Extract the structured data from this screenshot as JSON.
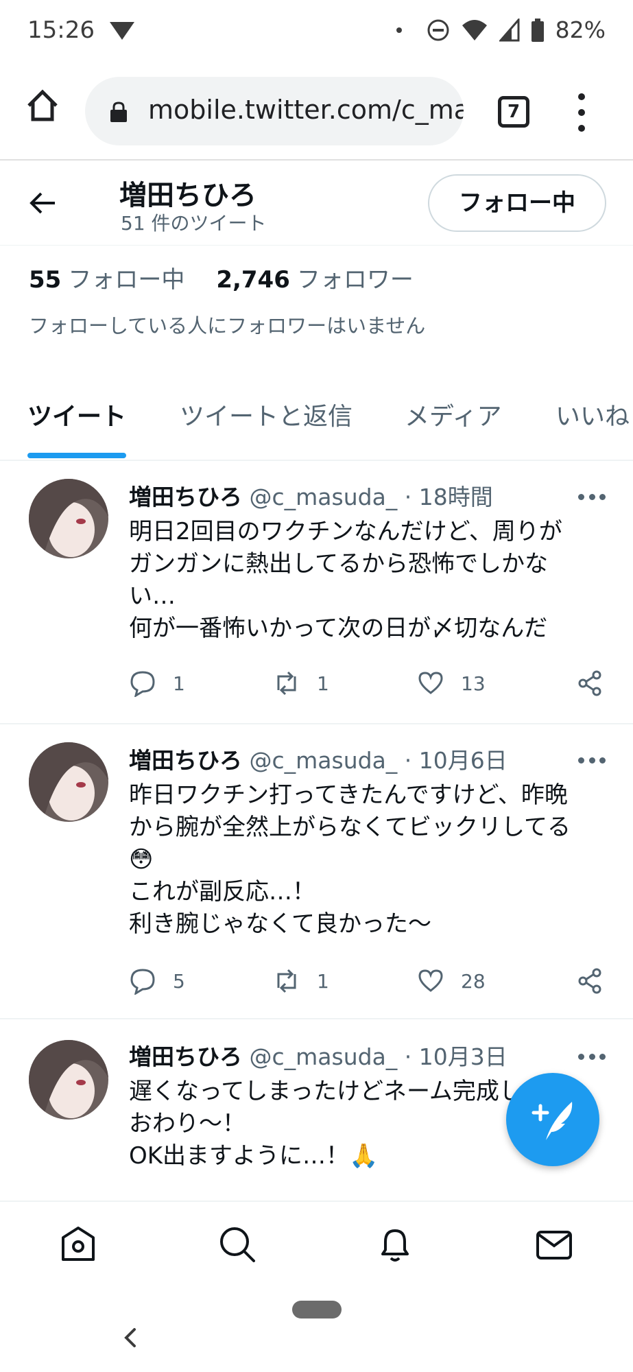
{
  "status_bar": {
    "time": "15:26",
    "battery": "82%"
  },
  "browser": {
    "url": "mobile.twitter.com/c_ma",
    "tab_count": "7"
  },
  "profile": {
    "name": "増田ちひろ",
    "tweet_count": "51 件のツイート",
    "follow_button": "フォロー中",
    "following_count": "55",
    "following_label": "フォロー中",
    "followers_count": "2,746",
    "followers_label": "フォロワー",
    "mutual_note": "フォローしている人にフォロワーはいません"
  },
  "tabs": [
    "ツイート",
    "ツイートと返信",
    "メディア",
    "いいね"
  ],
  "tweets": [
    {
      "name": "増田ちひろ",
      "handle": "@c_masuda_",
      "time": "· 18時間",
      "lines": [
        "明日2回目のワクチンなんだけど、周りが",
        "ガンガンに熱出してるから恐怖でしかな",
        "い…",
        "何が一番怖いかって次の日が〆切なんだ"
      ],
      "replies": "1",
      "retweets": "1",
      "likes": "13"
    },
    {
      "name": "増田ちひろ",
      "handle": "@c_masuda_",
      "time": "· 10月6日",
      "lines": [
        "昨日ワクチン打ってきたんですけど、昨晩",
        "から腕が全然上がらなくてビックリしてる",
        "😳",
        "これが副反応…！",
        "利き腕じゃなくて良かった〜"
      ],
      "replies": "5",
      "retweets": "1",
      "likes": "28"
    },
    {
      "name": "増田ちひろ",
      "handle": "@c_masuda_",
      "time": "· 10月3日",
      "lines": [
        "遅くなってしまったけどネーム完成した！",
        "おわり〜！",
        "OK出ますように…！🙏"
      ]
    }
  ],
  "colors": {
    "accent": "#1d9bf0",
    "text": "#0f1419",
    "secondary": "#536471"
  },
  "icons": {
    "status": [
      "signal-triangle-icon",
      "dnd-icon",
      "wifi-icon",
      "cell-signal-icon",
      "battery-icon"
    ],
    "bottom_nav": [
      "home-icon",
      "search-icon",
      "bell-icon",
      "mail-icon"
    ],
    "fab": "compose-icon"
  }
}
